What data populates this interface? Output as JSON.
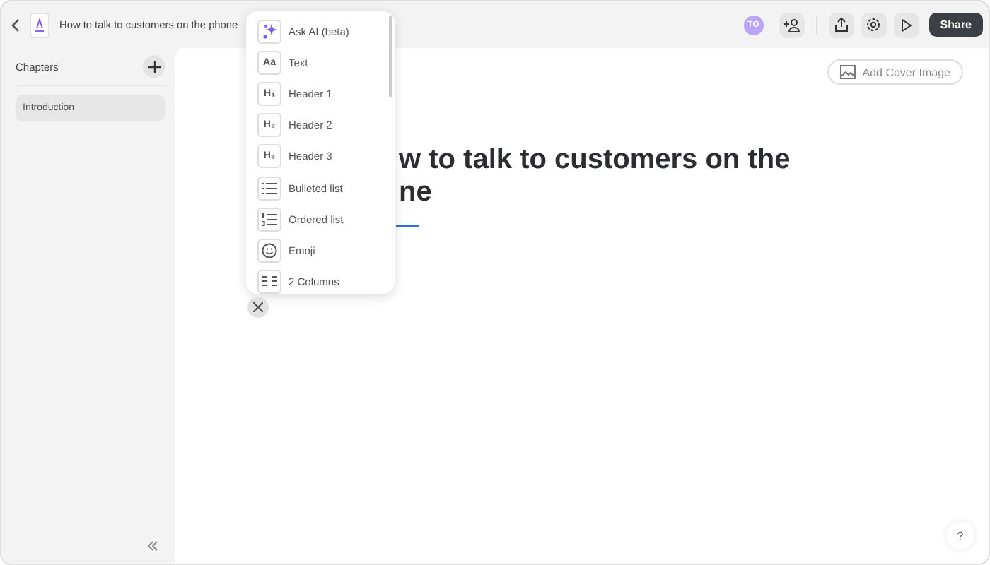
{
  "topbar": {
    "title": "How to talk to customers on the phone",
    "avatar": "TO",
    "share": "Share"
  },
  "sidebar": {
    "heading": "Chapters",
    "items": [
      {
        "label": "Introduction",
        "selected": true
      }
    ]
  },
  "content": {
    "cover_button": "Add Cover Image",
    "title_lines": [
      "w to talk to customers on the",
      "ne"
    ]
  },
  "block_menu": {
    "items": [
      {
        "kind": "ai",
        "label": "Ask AI (beta)"
      },
      {
        "kind": "text",
        "label": "Text",
        "glyph": "Aa"
      },
      {
        "kind": "heading",
        "label": "Header 1",
        "glyph": "H₁"
      },
      {
        "kind": "heading",
        "label": "Header 2",
        "glyph": "H₂"
      },
      {
        "kind": "heading",
        "label": "Header 3",
        "glyph": "H₃"
      },
      {
        "kind": "bullets",
        "label": "Bulleted list"
      },
      {
        "kind": "numbers",
        "label": "Ordered list"
      },
      {
        "kind": "emoji",
        "label": "Emoji"
      },
      {
        "kind": "columns",
        "label": "2 Columns"
      }
    ]
  },
  "help": "?"
}
